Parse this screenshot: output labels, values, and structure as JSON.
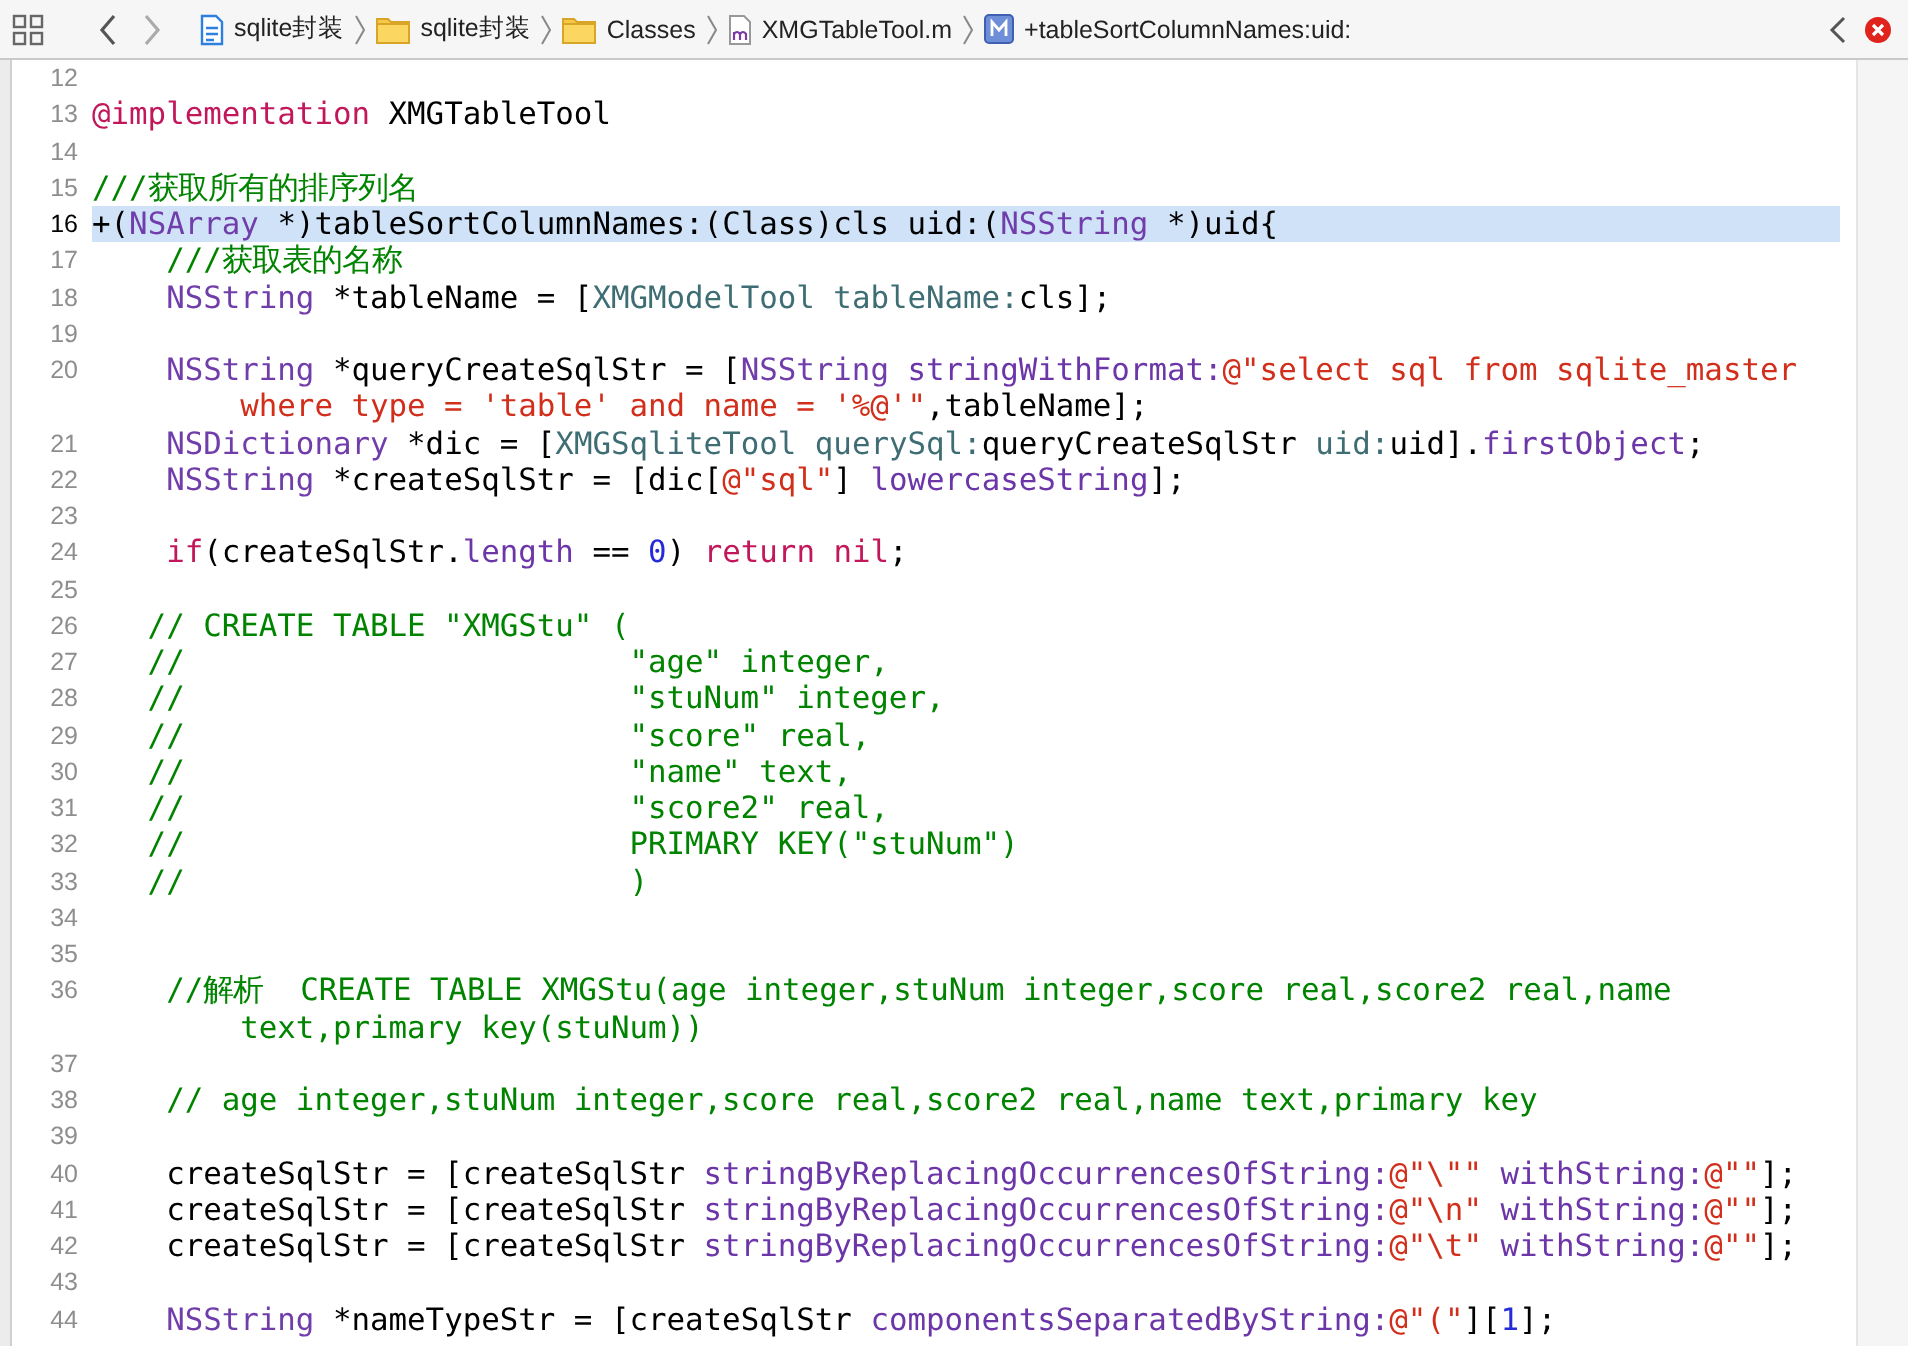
{
  "jump_bar": {
    "crumbs": [
      {
        "kind": "project",
        "label": "sqlite封装"
      },
      {
        "kind": "folder",
        "label": "sqlite封装"
      },
      {
        "kind": "folder",
        "label": "Classes"
      },
      {
        "kind": "file",
        "label": "XMGTableTool.m"
      },
      {
        "kind": "method",
        "label": "+tableSortColumnNames:uid:"
      }
    ]
  },
  "editor": {
    "lines": [
      {
        "number": "12",
        "current": false
      },
      {
        "number": "13",
        "current": false,
        "segments": [
          {
            "kind": "keyword",
            "text": "@implementation"
          },
          {
            "kind": "plain",
            "text": " XMGTableTool"
          }
        ]
      },
      {
        "number": "14",
        "current": false
      },
      {
        "number": "15",
        "current": false,
        "segments": [
          {
            "kind": "comment",
            "text": "///获取所有的排序列名"
          }
        ]
      },
      {
        "number": "16",
        "current": true,
        "segments": [
          {
            "kind": "plain",
            "text": "+("
          },
          {
            "kind": "type",
            "text": "NSArray"
          },
          {
            "kind": "plain",
            "text": " *)tableSortColumnNames:(Class)cls uid:("
          },
          {
            "kind": "type",
            "text": "NSString"
          },
          {
            "kind": "plain",
            "text": " *)uid{"
          }
        ]
      },
      {
        "number": "17",
        "current": false,
        "segments": [
          {
            "kind": "comment",
            "text": "    ///获取表的名称"
          }
        ]
      },
      {
        "number": "18",
        "current": false,
        "segments": [
          {
            "kind": "type",
            "text": "    NSString"
          },
          {
            "kind": "plain",
            "text": " *tableName = ["
          },
          {
            "kind": "class",
            "text": "XMGModelTool"
          },
          {
            "kind": "project_method",
            "text": " tableName:"
          },
          {
            "kind": "plain",
            "text": "cls];"
          }
        ]
      },
      {
        "number": "19",
        "current": false
      },
      {
        "number": "20",
        "current": false,
        "segments": [
          {
            "kind": "type",
            "text": "    NSString"
          },
          {
            "kind": "plain",
            "text": " *queryCreateSqlStr = ["
          },
          {
            "kind": "type",
            "text": "NSString"
          },
          {
            "kind": "method",
            "text": " stringWithFormat:"
          },
          {
            "kind": "string",
            "text": "@\"select sql from sqlite_master"
          }
        ],
        "continuation": [
          {
            "kind": "string",
            "text": "        where type = 'table' and name = '%@'\""
          },
          {
            "kind": "plain",
            "text": ",tableName];"
          }
        ]
      },
      {
        "number": "21",
        "current": false,
        "segments": [
          {
            "kind": "type",
            "text": "    NSDictionary"
          },
          {
            "kind": "plain",
            "text": " *dic = ["
          },
          {
            "kind": "class",
            "text": "XMGSqliteTool"
          },
          {
            "kind": "project_method",
            "text": " querySql:"
          },
          {
            "kind": "plain",
            "text": "queryCreateSqlStr "
          },
          {
            "kind": "project_method",
            "text": "uid:"
          },
          {
            "kind": "plain",
            "text": "uid]."
          },
          {
            "kind": "method",
            "text": "firstObject"
          },
          {
            "kind": "plain",
            "text": ";"
          }
        ]
      },
      {
        "number": "22",
        "current": false,
        "segments": [
          {
            "kind": "type",
            "text": "    NSString"
          },
          {
            "kind": "plain",
            "text": " *createSqlStr = [dic["
          },
          {
            "kind": "string",
            "text": "@\"sql\""
          },
          {
            "kind": "plain",
            "text": "] "
          },
          {
            "kind": "method",
            "text": "lowercaseString"
          },
          {
            "kind": "plain",
            "text": "];"
          }
        ]
      },
      {
        "number": "23",
        "current": false
      },
      {
        "number": "24",
        "current": false,
        "segments": [
          {
            "kind": "keyword",
            "text": "    if"
          },
          {
            "kind": "plain",
            "text": "(createSqlStr."
          },
          {
            "kind": "method",
            "text": "length"
          },
          {
            "kind": "plain",
            "text": " == "
          },
          {
            "kind": "number",
            "text": "0"
          },
          {
            "kind": "plain",
            "text": ") "
          },
          {
            "kind": "keyword",
            "text": "return"
          },
          {
            "kind": "keyword",
            "text": " nil"
          },
          {
            "kind": "plain",
            "text": ";"
          }
        ]
      },
      {
        "number": "25",
        "current": false
      },
      {
        "number": "26",
        "current": false,
        "segments": [
          {
            "kind": "comment",
            "text": "   // CREATE TABLE \"XMGStu\" ("
          }
        ]
      },
      {
        "number": "27",
        "current": false,
        "segments": [
          {
            "kind": "comment",
            "text": "   //                        \"age\" integer,"
          }
        ]
      },
      {
        "number": "28",
        "current": false,
        "segments": [
          {
            "kind": "comment",
            "text": "   //                        \"stuNum\" integer,"
          }
        ]
      },
      {
        "number": "29",
        "current": false,
        "segments": [
          {
            "kind": "comment",
            "text": "   //                        \"score\" real,"
          }
        ]
      },
      {
        "number": "30",
        "current": false,
        "segments": [
          {
            "kind": "comment",
            "text": "   //                        \"name\" text,"
          }
        ]
      },
      {
        "number": "31",
        "current": false,
        "segments": [
          {
            "kind": "comment",
            "text": "   //                        \"score2\" real,"
          }
        ]
      },
      {
        "number": "32",
        "current": false,
        "segments": [
          {
            "kind": "comment",
            "text": "   //                        PRIMARY KEY(\"stuNum\")"
          }
        ]
      },
      {
        "number": "33",
        "current": false,
        "segments": [
          {
            "kind": "comment",
            "text": "   //                        )"
          }
        ]
      },
      {
        "number": "34",
        "current": false
      },
      {
        "number": "35",
        "current": false
      },
      {
        "number": "36",
        "current": false,
        "segments": [
          {
            "kind": "comment",
            "text": "    //解析  CREATE TABLE XMGStu(age integer,stuNum integer,score real,score2 real,name"
          }
        ],
        "continuation": [
          {
            "kind": "comment",
            "text": "        text,primary key(stuNum))"
          }
        ]
      },
      {
        "number": "37",
        "current": false
      },
      {
        "number": "38",
        "current": false,
        "segments": [
          {
            "kind": "comment",
            "text": "    // age integer,stuNum integer,score real,score2 real,name text,primary key"
          }
        ]
      },
      {
        "number": "39",
        "current": false
      },
      {
        "number": "40",
        "current": false,
        "segments": [
          {
            "kind": "plain",
            "text": "    createSqlStr = [createSqlStr "
          },
          {
            "kind": "method",
            "text": "stringByReplacingOccurrencesOfString:"
          },
          {
            "kind": "string",
            "text": "@\"\\\"\""
          },
          {
            "kind": "method",
            "text": " withString:"
          },
          {
            "kind": "string",
            "text": "@\"\""
          },
          {
            "kind": "plain",
            "text": "];"
          }
        ]
      },
      {
        "number": "41",
        "current": false,
        "segments": [
          {
            "kind": "plain",
            "text": "    createSqlStr = [createSqlStr "
          },
          {
            "kind": "method",
            "text": "stringByReplacingOccurrencesOfString:"
          },
          {
            "kind": "string",
            "text": "@\"\\n\""
          },
          {
            "kind": "method",
            "text": " withString:"
          },
          {
            "kind": "string",
            "text": "@\"\""
          },
          {
            "kind": "plain",
            "text": "];"
          }
        ]
      },
      {
        "number": "42",
        "current": false,
        "segments": [
          {
            "kind": "plain",
            "text": "    createSqlStr = [createSqlStr "
          },
          {
            "kind": "method",
            "text": "stringByReplacingOccurrencesOfString:"
          },
          {
            "kind": "string",
            "text": "@\"\\t\""
          },
          {
            "kind": "method",
            "text": " withString:"
          },
          {
            "kind": "string",
            "text": "@\"\""
          },
          {
            "kind": "plain",
            "text": "];"
          }
        ]
      },
      {
        "number": "43",
        "current": false
      },
      {
        "number": "44",
        "current": false,
        "segments": [
          {
            "kind": "type",
            "text": "    NSString"
          },
          {
            "kind": "plain",
            "text": " *nameTypeStr = [createSqlStr "
          },
          {
            "kind": "method",
            "text": "componentsSeparatedByString:"
          },
          {
            "kind": "string",
            "text": "@\"(\""
          },
          {
            "kind": "plain",
            "text": "]["
          },
          {
            "kind": "number",
            "text": "1"
          },
          {
            "kind": "plain",
            "text": "];"
          }
        ]
      }
    ]
  }
}
